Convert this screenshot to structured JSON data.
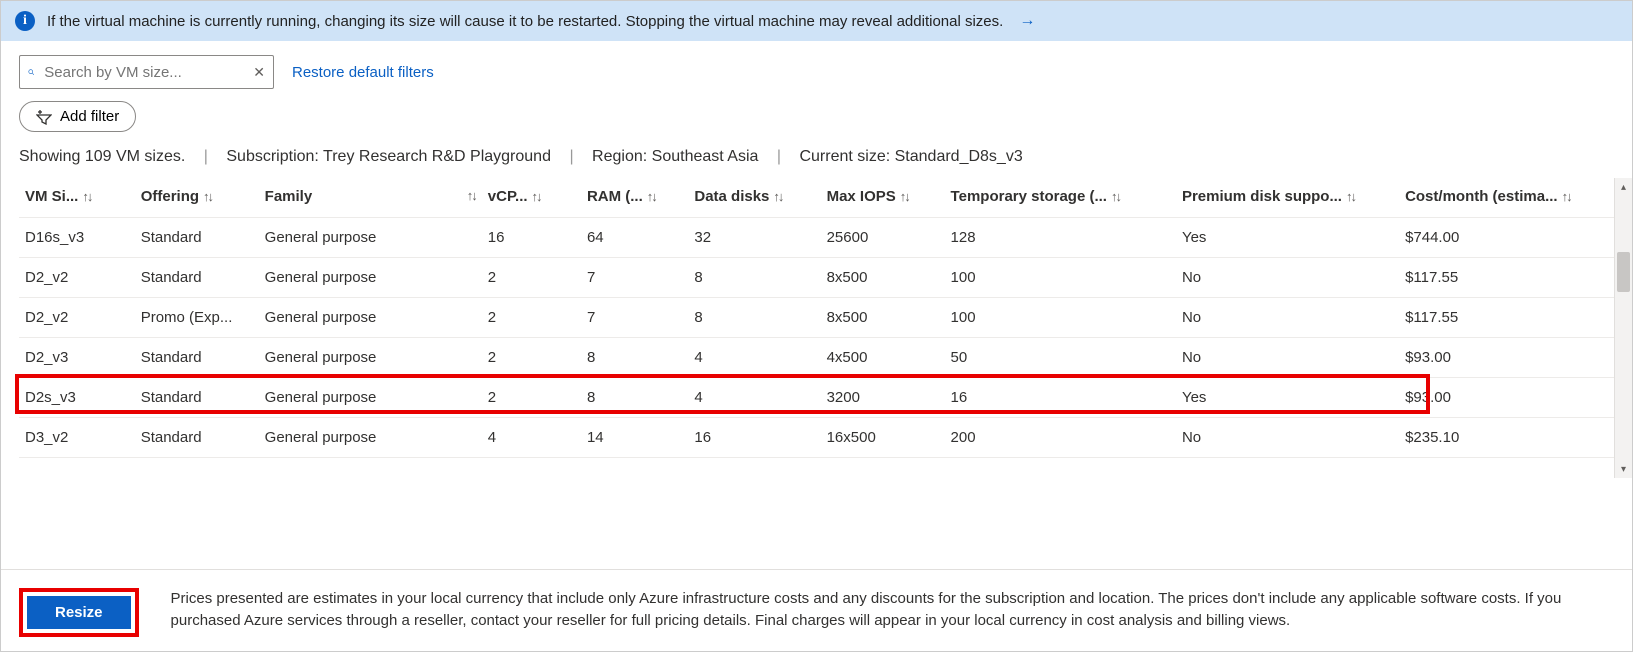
{
  "banner": {
    "text": "If the virtual machine is currently running, changing its size will cause it to be restarted. Stopping the virtual machine may reveal additional sizes."
  },
  "search": {
    "placeholder": "Search by VM size..."
  },
  "links": {
    "restore": "Restore default filters"
  },
  "buttons": {
    "add_filter": "Add filter",
    "resize": "Resize"
  },
  "status": {
    "count_text": "Showing 109 VM sizes.",
    "subscription_label": "Subscription:",
    "subscription_value": "Trey Research R&D Playground",
    "region_label": "Region:",
    "region_value": "Southeast Asia",
    "current_label": "Current size:",
    "current_value": "Standard_D8s_v3"
  },
  "columns": {
    "size": "VM Si...",
    "offering": "Offering",
    "family": "Family",
    "vcpu": "vCP...",
    "ram": "RAM (...",
    "disks": "Data disks",
    "iops": "Max IOPS",
    "temp": "Temporary storage (...",
    "premium": "Premium disk suppo...",
    "cost": "Cost/month (estima..."
  },
  "rows": [
    {
      "size": "D16s_v3",
      "offering": "Standard",
      "family": "General purpose",
      "vcpu": "16",
      "ram": "64",
      "disks": "32",
      "iops": "25600",
      "temp": "128",
      "premium": "Yes",
      "cost": "$744.00",
      "hl": false
    },
    {
      "size": "D2_v2",
      "offering": "Standard",
      "family": "General purpose",
      "vcpu": "2",
      "ram": "7",
      "disks": "8",
      "iops": "8x500",
      "temp": "100",
      "premium": "No",
      "cost": "$117.55",
      "hl": false
    },
    {
      "size": "D2_v2",
      "offering": "Promo (Exp...",
      "family": "General purpose",
      "vcpu": "2",
      "ram": "7",
      "disks": "8",
      "iops": "8x500",
      "temp": "100",
      "premium": "No",
      "cost": "$117.55",
      "hl": false
    },
    {
      "size": "D2_v3",
      "offering": "Standard",
      "family": "General purpose",
      "vcpu": "2",
      "ram": "8",
      "disks": "4",
      "iops": "4x500",
      "temp": "50",
      "premium": "No",
      "cost": "$93.00",
      "hl": false
    },
    {
      "size": "D2s_v3",
      "offering": "Standard",
      "family": "General purpose",
      "vcpu": "2",
      "ram": "8",
      "disks": "4",
      "iops": "3200",
      "temp": "16",
      "premium": "Yes",
      "cost": "$93.00",
      "hl": true
    },
    {
      "size": "D3_v2",
      "offering": "Standard",
      "family": "General purpose",
      "vcpu": "4",
      "ram": "14",
      "disks": "16",
      "iops": "16x500",
      "temp": "200",
      "premium": "No",
      "cost": "$235.10",
      "hl": false
    }
  ],
  "footer_note": "Prices presented are estimates in your local currency that include only Azure infrastructure costs and any discounts for the subscription and location. The prices don't include any applicable software costs. If you purchased Azure services through a reseller, contact your reseller for full pricing details. Final charges will appear in your local currency in cost analysis and billing views."
}
